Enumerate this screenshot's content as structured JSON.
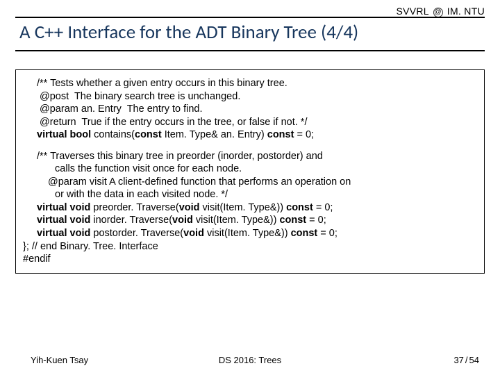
{
  "header": {
    "org_left": "SVVRL",
    "org_right": "IM. NTU",
    "title": "A C++ Interface for the ADT Binary Tree (4/4)"
  },
  "code": {
    "block1": {
      "l1": "/** Tests whether a given entry occurs in this binary tree.",
      "l2": " @post  The binary search tree is unchanged.",
      "l3": " @param an. Entry  The entry to find.",
      "l4": " @return  True if the entry occurs in the tree, or false if not. */",
      "sig_pre": "virtual bool ",
      "sig_mid1": "contains(",
      "sig_kw": "const ",
      "sig_mid2": "Item. Type& an. Entry) ",
      "sig_kw2": "const ",
      "sig_post": "= 0;"
    },
    "block2": {
      "l1": "/** Traverses this binary tree in preorder (inorder, postorder) and",
      "l2": "calls the function visit once for each node.",
      "l3": " @param visit A client-defined function that performs an operation on",
      "l4": "or with the data in each visited node. */",
      "pre_kw1": "virtual void ",
      "pre_mid": "preorder. Traverse(",
      "pre_kw2": "void ",
      "pre_mid2": "visit(Item. Type&)) ",
      "pre_kw3": "const ",
      "pre_end": "= 0;",
      "in_kw1": "virtual void ",
      "in_mid": "inorder. Traverse(",
      "in_kw2": "void ",
      "in_mid2": "visit(Item. Type&)) ",
      "in_kw3": "const ",
      "in_end": "= 0;",
      "po_kw1": "virtual void ",
      "po_mid": "postorder. Traverse(",
      "po_kw2": "void ",
      "po_mid2": "visit(Item. Type&)) ",
      "po_kw3": "const ",
      "po_end": "= 0;",
      "close": "}; // end Binary. Tree. Interface",
      "endif": "#endif"
    }
  },
  "footer": {
    "author": "Yih-Kuen Tsay",
    "course": "DS 2016: Trees",
    "page_current": "37",
    "page_total": "54"
  }
}
